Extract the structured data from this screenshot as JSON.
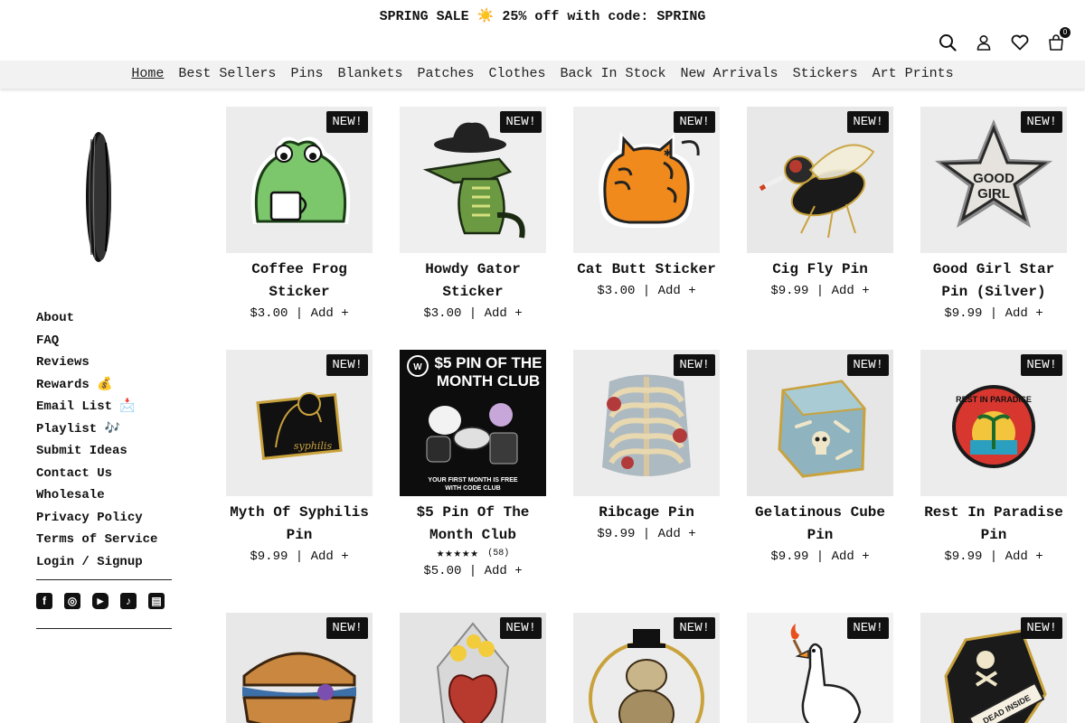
{
  "announcement": "SPRING SALE ☀️ 25% off with code: SPRING",
  "header": {
    "icons": [
      "search-icon",
      "account-icon",
      "heart-icon",
      "cart-icon"
    ],
    "cart_count": "0"
  },
  "nav": [
    {
      "label": "Home",
      "active": true
    },
    {
      "label": "Best Sellers"
    },
    {
      "label": "Pins"
    },
    {
      "label": "Blankets"
    },
    {
      "label": "Patches"
    },
    {
      "label": "Clothes"
    },
    {
      "label": "Back In Stock"
    },
    {
      "label": "New Arrivals"
    },
    {
      "label": "Stickers"
    },
    {
      "label": "Art Prints"
    }
  ],
  "sidebar": {
    "links": [
      "About",
      "FAQ",
      "Reviews",
      "Rewards 💰",
      "Email List 📩",
      "Playlist 🎶",
      "Submit Ideas",
      "Contact Us",
      "Wholesale",
      "Privacy Policy",
      "Terms of Service",
      "Login / Signup"
    ],
    "social": [
      "facebook-icon",
      "instagram-icon",
      "youtube-icon",
      "tiktok-icon",
      "twitch-icon"
    ]
  },
  "badge_label": "NEW!",
  "add_label": "Add +",
  "products": [
    {
      "name": "Coffee Frog Sticker",
      "price": "$3.00",
      "badge": true,
      "art": "frog"
    },
    {
      "name": "Howdy Gator Sticker",
      "price": "$3.00",
      "badge": true,
      "art": "gator"
    },
    {
      "name": "Cat Butt Sticker",
      "price": "$3.00",
      "badge": true,
      "art": "cat"
    },
    {
      "name": "Cig Fly Pin",
      "price": "$9.99",
      "badge": true,
      "art": "fly"
    },
    {
      "name": "Good Girl Star Pin (Silver)",
      "price": "$9.99",
      "badge": true,
      "art": "star"
    },
    {
      "name": "Myth Of Syphilis Pin",
      "price": "$9.99",
      "badge": true,
      "art": "syphilis"
    },
    {
      "name": "$5 Pin Of The Month Club",
      "price": "$5.00",
      "badge": false,
      "art": "club",
      "rating": 5,
      "reviews": "(58)"
    },
    {
      "name": "Ribcage Pin",
      "price": "$9.99",
      "badge": true,
      "art": "ribcage"
    },
    {
      "name": "Gelatinous Cube Pin",
      "price": "$9.99",
      "badge": true,
      "art": "cube"
    },
    {
      "name": "Rest In Paradise Pin",
      "price": "$9.99",
      "badge": true,
      "art": "paradise"
    },
    {
      "name": "",
      "price": "",
      "badge": true,
      "art": "sandwich"
    },
    {
      "name": "",
      "price": "",
      "badge": true,
      "art": "heart"
    },
    {
      "name": "",
      "price": "",
      "badge": true,
      "art": "possum"
    },
    {
      "name": "",
      "price": "",
      "badge": true,
      "art": "goose"
    },
    {
      "name": "",
      "price": "",
      "badge": true,
      "art": "coffin"
    }
  ],
  "art_text": {
    "star": "GOOD GIRL",
    "syphilis": "syphilis",
    "club_title": "$5 PIN OF THE MONTH CLUB",
    "club_footer": "YOUR FIRST MONTH IS FREE WITH CODE CLUB",
    "paradise": "REST IN PARADISE",
    "coffin": "DEAD INSIDE"
  }
}
